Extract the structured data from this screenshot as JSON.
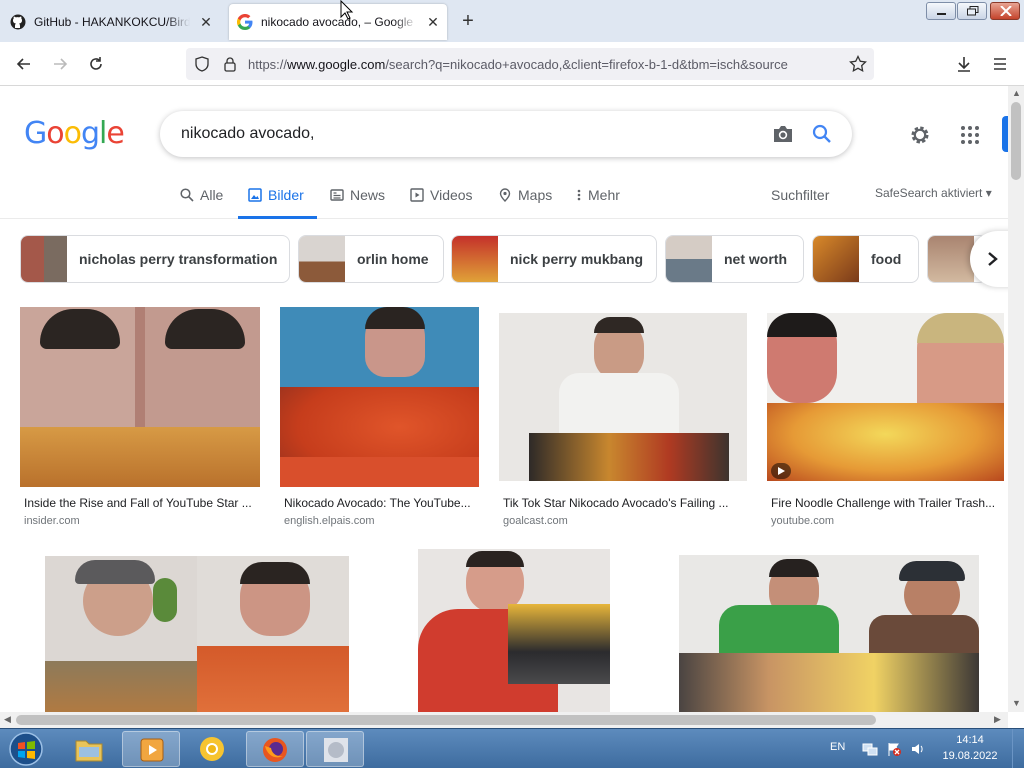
{
  "browser": {
    "tabs": [
      {
        "title": "GitHub - HAKANKOKCU/BirdyIn",
        "favicon": "github-icon"
      },
      {
        "title": "nikocado avocado, – Google Suche",
        "favicon": "google-g-icon",
        "active": true
      }
    ],
    "url_prefix": "https://",
    "url_host": "www.google.com",
    "url_rest": "/search?q=nikocado+avocado,&client=firefox-b-1-d&tbm=isch&source"
  },
  "google": {
    "query": "nikocado avocado,",
    "tabs": [
      {
        "label": "Alle",
        "icon": "search-icon"
      },
      {
        "label": "Bilder",
        "icon": "image-icon",
        "active": true
      },
      {
        "label": "News",
        "icon": "news-icon"
      },
      {
        "label": "Videos",
        "icon": "play-icon"
      },
      {
        "label": "Maps",
        "icon": "map-pin-icon"
      },
      {
        "label": "Mehr",
        "icon": "more-vertical-icon"
      }
    ],
    "suchfilter": "Suchfilter",
    "safesearch": "SafeSearch aktiviert"
  },
  "chips": [
    {
      "label": "nicholas perry transformation"
    },
    {
      "label": "orlin home"
    },
    {
      "label": "nick perry mukbang"
    },
    {
      "label": "net worth"
    },
    {
      "label": "food"
    }
  ],
  "results": [
    {
      "caption": "Inside the Rise and Fall of YouTube Star ...",
      "source": "insider.com"
    },
    {
      "caption": "Nikocado Avocado: The YouTube...",
      "source": "english.elpais.com"
    },
    {
      "caption": "Tik Tok Star Nikocado Avocado's Failing ...",
      "source": "goalcast.com"
    },
    {
      "caption": "Fire Noodle Challenge with Trailer Trash...",
      "source": "youtube.com"
    },
    {
      "caption": "",
      "source": ""
    },
    {
      "caption": "",
      "source": ""
    },
    {
      "caption": "",
      "source": ""
    }
  ],
  "taskbar": {
    "language": "EN",
    "time": "14:14",
    "date": "19.08.2022"
  },
  "colors": {
    "google_blue": "#1a73e8",
    "tabstrip": "#dfe7f2",
    "taskbar": "#4a78ab"
  }
}
